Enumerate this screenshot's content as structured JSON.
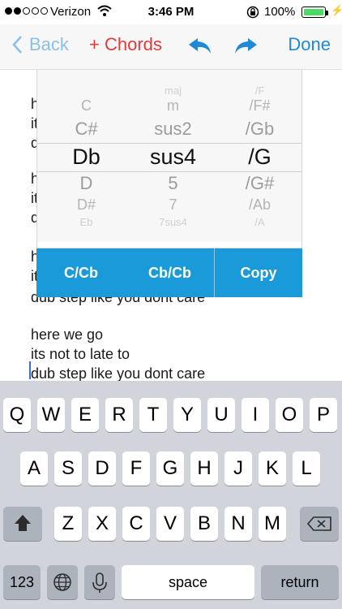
{
  "status_bar": {
    "carrier": "Verizon",
    "time": "3:46 PM",
    "battery_percent": "100%",
    "battery_level": 1.0,
    "signal_bars": 2,
    "icons": [
      "signal-dots-icon",
      "wifi-icon",
      "rotation-lock-icon",
      "battery-icon",
      "charging-bolt-icon"
    ]
  },
  "nav": {
    "back_label": "Back",
    "chords_label": "+ Chords",
    "done_label": "Done",
    "icons": [
      "chevron-left-icon",
      "undo-icon",
      "redo-icon"
    ],
    "colors": {
      "back": "#8cbfe7",
      "chords": "#e23b3b",
      "accent": "#1e8ad6"
    }
  },
  "editor": {
    "hidden_lines": [
      "h",
      "it",
      "d",
      "h",
      "it",
      "d",
      "h",
      "it"
    ],
    "lines": [
      "dub step like you dont care",
      "here we go",
      "its not to late to",
      "dub step like you dont care"
    ]
  },
  "picker": {
    "root": [
      "C",
      "C#",
      "Db",
      "D",
      "D#",
      "Eb"
    ],
    "quality": [
      "maj",
      "m",
      "sus2",
      "sus4",
      "5",
      "7",
      "7sus4"
    ],
    "bass": [
      "/F",
      "/F#",
      "/Gb",
      "/G",
      "/G#",
      "/Ab",
      "/A"
    ],
    "selected": {
      "root": "Db",
      "quality": "sus4",
      "bass": "/G"
    }
  },
  "actions": {
    "c_cb": "C/Cb",
    "cb_cb": "Cb/Cb",
    "copy": "Copy",
    "color": "#1a9ad8"
  },
  "keyboard": {
    "row1": [
      "Q",
      "W",
      "E",
      "R",
      "T",
      "Y",
      "U",
      "I",
      "O",
      "P"
    ],
    "row2": [
      "A",
      "S",
      "D",
      "F",
      "G",
      "H",
      "J",
      "K",
      "L"
    ],
    "row3": [
      "Z",
      "X",
      "C",
      "V",
      "B",
      "N",
      "M"
    ],
    "numbers_key": "123",
    "space_key": "space",
    "return_key": "return",
    "icons": [
      "shift-icon",
      "backspace-icon",
      "globe-icon",
      "microphone-icon"
    ]
  }
}
